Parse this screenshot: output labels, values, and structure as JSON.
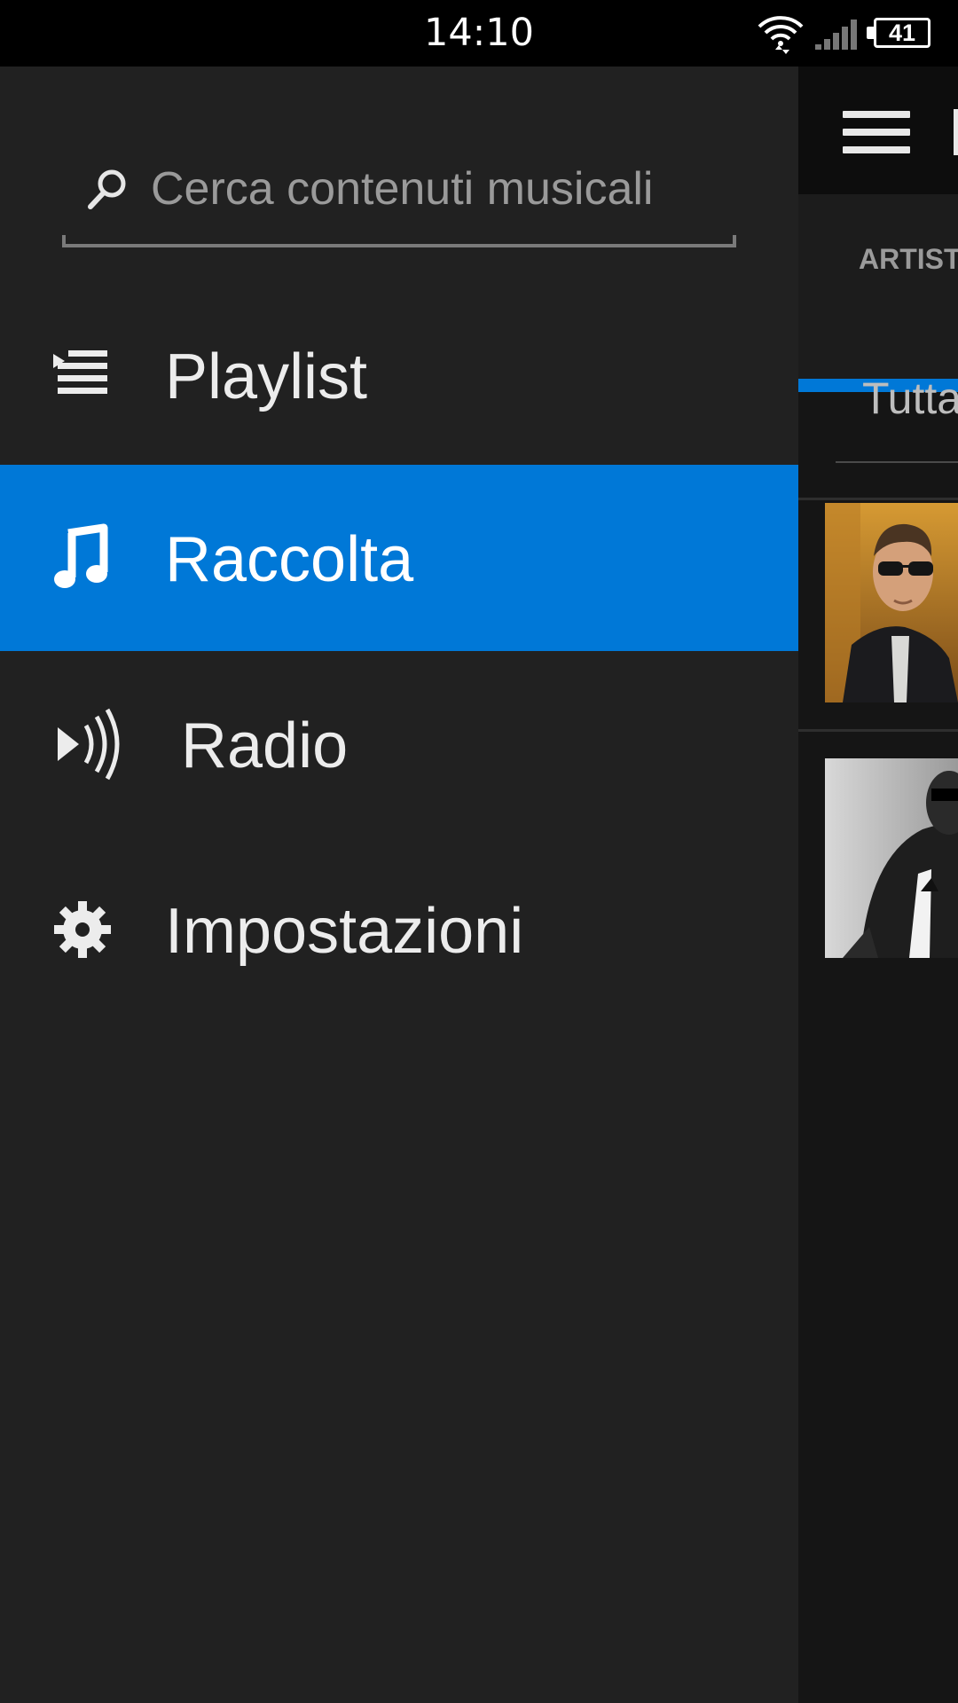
{
  "status_bar": {
    "time": "14:10",
    "battery_level": "41",
    "icons": [
      "wifi-icon",
      "signal-icon",
      "battery-icon"
    ]
  },
  "drawer": {
    "search": {
      "placeholder": "Cerca contenuti musicali",
      "icon": "search-icon"
    },
    "items": [
      {
        "label": "Playlist",
        "icon": "playlist-icon",
        "selected": false
      },
      {
        "label": "Raccolta",
        "icon": "music-note-icon",
        "selected": true
      },
      {
        "label": "Radio",
        "icon": "radio-icon",
        "selected": false
      },
      {
        "label": "Impostazioni",
        "icon": "gear-icon",
        "selected": false
      }
    ]
  },
  "background_app": {
    "tab_label": "ARTIST",
    "filter_label": "Tutta",
    "accent_color": "#0078d7"
  },
  "colors": {
    "drawer_bg": "#212121",
    "accent": "#0078d7",
    "status_bar_bg": "#000000"
  }
}
